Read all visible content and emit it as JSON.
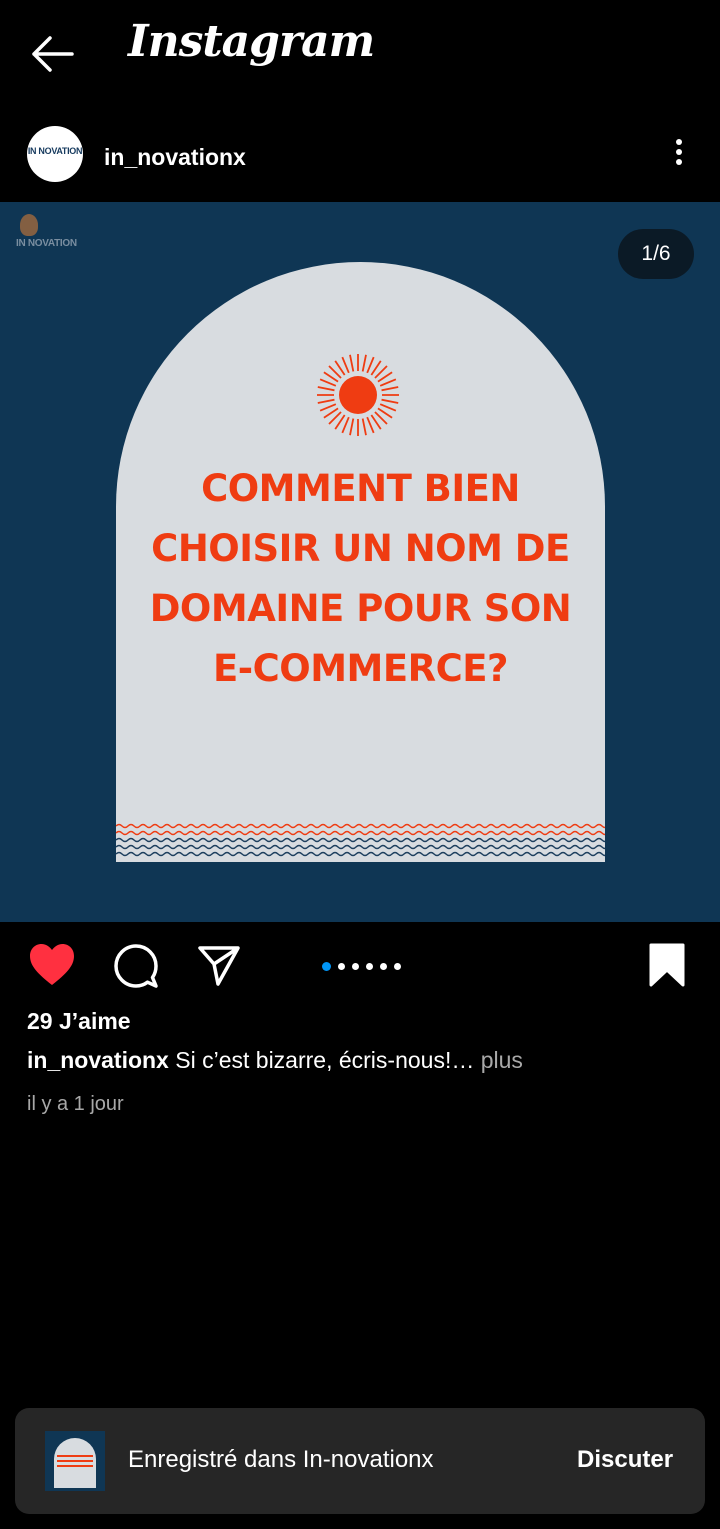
{
  "app": {
    "title": "Instagram"
  },
  "post": {
    "username": "in_novationx",
    "avatar_text": "IN NOVATION",
    "media": {
      "counter": "1/6",
      "brand_text": "IN NOVATION",
      "headline_lines": [
        "COMMENT BIEN",
        "CHOISIR UN NOM DE",
        "DOMAINE POUR SON",
        "E-COMMERCE?"
      ],
      "slide_count": 6,
      "active_slide": 1
    },
    "likes": "29 J’aime",
    "caption_user": "in_novationx",
    "caption_text": " Si c’est bizarre, écris-nous!…",
    "caption_more": " plus",
    "timestamp": "il y a 1 jour",
    "liked": true,
    "saved": true
  },
  "toast": {
    "text": "Enregistré dans In-novationx",
    "action": "Discuter"
  },
  "icons": {
    "back": "arrow-left-icon",
    "more": "more-vertical-icon",
    "like": "heart-icon",
    "comment": "comment-bubble-icon",
    "share": "paper-plane-icon",
    "save": "bookmark-icon"
  },
  "colors": {
    "like": "#ff3040",
    "active_dot": "#0095f6",
    "media_bg": "#0f3654",
    "headline": "#ef3c12",
    "arch": "#d8dce0"
  }
}
